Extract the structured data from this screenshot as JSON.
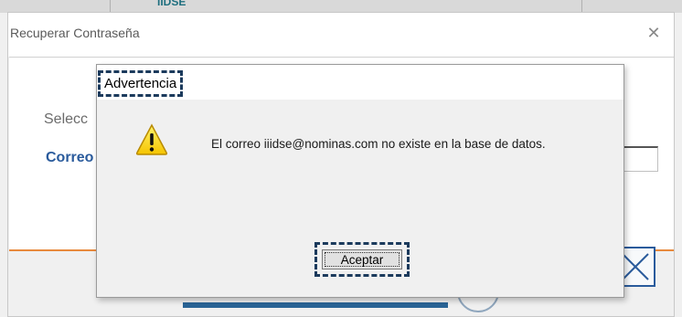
{
  "background": {
    "fragment_text": "IIDSE"
  },
  "outer_dialog": {
    "title": "Recuperar Contraseña",
    "close_glyph": "✕",
    "label_select": "Selecc",
    "label_email": "Correo"
  },
  "alert": {
    "title": "Advertencia",
    "icon": "warning-icon",
    "message": "El correo iiidse@nominas.com no existe en la base de datos.",
    "ok_label": "Aceptar"
  },
  "colors": {
    "accent_orange": "#e8893d",
    "brand_blue": "#2a5b9c",
    "focus_dash": "#1b3a5c"
  }
}
